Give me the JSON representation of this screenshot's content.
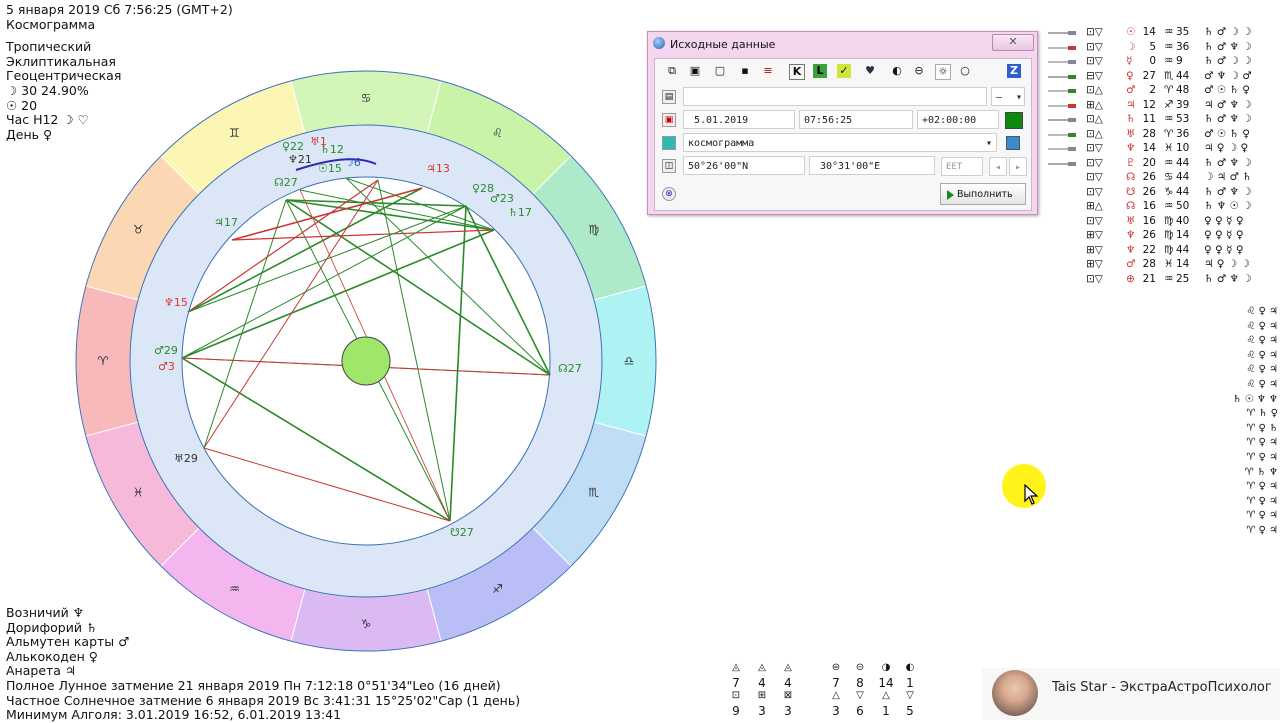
{
  "header": {
    "date_line": "5 января 2019  Сб   7:56:25 (GMT+2)",
    "chart_type": "Космограмма"
  },
  "settings": {
    "zodiac": "Тропический",
    "coords": "Эклиптикальная",
    "center": "Геоцентрическая",
    "moon_line": "☽  30 24.90%",
    "sun_line": "☉  20",
    "hour_line": "Час Н12  ☽ ♡",
    "day_line": "День ♀"
  },
  "bottom_info": [
    "Возничий ♆",
    "Дорифорий ♄",
    "Альмутен карты ♂",
    "Алькокоден ♀",
    "Анарета ♃",
    "Полное Лунное затмение 21 января 2019 Пн   7:12:18   0°51'34\"Leo (16 дней)",
    "Частное Солнечное затмение 6 января 2019 Вс   3:41:31  15°25'02\"Cap (1 день)",
    "Минимум Алголя: 3.01.2019 16:52,  6.01.2019 13:41"
  ],
  "wheel": {
    "signs": [
      "♈",
      "♉",
      "♊",
      "♋",
      "♌",
      "♍",
      "♎",
      "♏",
      "♐",
      "♑",
      "♒",
      "♓"
    ],
    "sign_colors": [
      "#f7b9b9",
      "#fbd7b3",
      "#fbf6b3",
      "#d4f5b8",
      "#c9f3a9",
      "#aee9c9",
      "#aef3f3",
      "#c0ddf6",
      "#b9bff6",
      "#dbb9f3",
      "#f4b6ee",
      "#f7b9d9"
    ],
    "planets": [
      {
        "g": "♅",
        "n": "1",
        "c": "#d33"
      },
      {
        "g": "♃",
        "n": "13",
        "c": "#d33"
      },
      {
        "g": "♀",
        "n": "22",
        "c": "#2a8a2a"
      },
      {
        "g": "♄",
        "n": "12",
        "c": "#2a8a2a"
      },
      {
        "g": "♆",
        "n": "21",
        "c": "#333"
      },
      {
        "g": "☉",
        "n": "15",
        "c": "#2a8a2a"
      },
      {
        "g": "☽",
        "n": "6",
        "c": "#2a5fb5"
      },
      {
        "g": "☊",
        "n": "27",
        "c": "#2a8a2a"
      },
      {
        "g": "♀",
        "n": "28",
        "c": "#2a8a2a"
      },
      {
        "g": "♂",
        "n": "23",
        "c": "#2a8a2a"
      },
      {
        "g": "♄",
        "n": "17",
        "c": "#2a8a2a"
      },
      {
        "g": "♃",
        "n": "17",
        "c": "#2a8a2a"
      },
      {
        "g": "♆",
        "n": "15",
        "c": "#d33"
      },
      {
        "g": "♂",
        "n": "29",
        "c": "#2a8a2a"
      },
      {
        "g": "♂",
        "n": "3",
        "c": "#d33"
      },
      {
        "g": "♅",
        "n": "29",
        "c": "#333"
      },
      {
        "g": "☊",
        "n": "27",
        "c": "#2a8a2a"
      },
      {
        "g": "☋",
        "n": "27",
        "c": "#2a8a2a"
      }
    ]
  },
  "dialog": {
    "title": "Исходные данные",
    "close": "✕",
    "date": "5.01.2019",
    "time": "07:56:25",
    "tz": "+02:00:00",
    "mode": "космограмма",
    "lat": "50°26'00\"N",
    "lon": "30°31'00\"E",
    "zone": "EET",
    "run": "Выполнить",
    "toolbar": [
      "⧉",
      "▣",
      "▢",
      "▪",
      "≡",
      "K",
      "L",
      "✓",
      "♥",
      "◐",
      "⊖",
      "☼",
      "○",
      "Z"
    ],
    "spin_left": "◂",
    "spin_right": "▸",
    "dropdown_dash": "—"
  },
  "aspect_table": {
    "rows": [
      {
        "a": "⊡▽",
        "p": "☉",
        "d": "14",
        "s": "♒",
        "m": "35",
        "e": "♄ ♂ ☽ ☽"
      },
      {
        "a": "⊡▽",
        "p": "☽",
        "d": "5",
        "s": "♒",
        "m": "36",
        "e": "♄ ♂ ♆ ☽"
      },
      {
        "a": "⊡▽",
        "p": "☿",
        "d": "0",
        "s": "♒",
        "m": "9",
        "e": "♄ ♂ ☽ ☽"
      },
      {
        "a": "⊟▽",
        "p": "♀",
        "d": "27",
        "s": "♏",
        "m": "44",
        "e": "♂ ♆ ☽ ♂"
      },
      {
        "a": "⊡△",
        "p": "♂",
        "d": "2",
        "s": "♈",
        "m": "48",
        "e": "♂ ☉ ♄ ♀"
      },
      {
        "a": "⊞△",
        "p": "♃",
        "d": "12",
        "s": "♐",
        "m": "39",
        "e": "♃ ♂ ♆ ☽"
      },
      {
        "a": "⊡△",
        "p": "♄",
        "d": "11",
        "s": "♒",
        "m": "53",
        "e": "♄ ♂ ♆ ☽"
      },
      {
        "a": "⊡△",
        "p": "♅",
        "d": "28",
        "s": "♈",
        "m": "36",
        "e": "♂ ☉ ♄ ♀"
      },
      {
        "a": "⊡▽",
        "p": "♆",
        "d": "14",
        "s": "♓",
        "m": "10",
        "e": "♃ ♀ ☽ ♀"
      },
      {
        "a": "⊡▽",
        "p": "♇",
        "d": "20",
        "s": "♒",
        "m": "44",
        "e": "♄ ♂ ♆ ☽"
      },
      {
        "a": "⊡▽",
        "p": "☊",
        "d": "26",
        "s": "♋",
        "m": "44",
        "e": "☽ ♃ ♂ ♄"
      },
      {
        "a": "⊡▽",
        "p": "☋",
        "d": "26",
        "s": "♑",
        "m": "44",
        "e": "♄ ♂ ♆ ☽"
      },
      {
        "a": "⊞△",
        "p": "☊",
        "d": "16",
        "s": "♒",
        "m": "50",
        "e": "♄ ♆ ☉ ☽"
      },
      {
        "a": "⊡▽",
        "p": "♅",
        "d": "16",
        "s": "♍",
        "m": "40",
        "e": "♀ ♀ ☿ ♀"
      },
      {
        "a": "⊞▽",
        "p": "♆",
        "d": "26",
        "s": "♍",
        "m": "14",
        "e": "♀ ♀ ☿ ♀"
      },
      {
        "a": "⊞▽",
        "p": "♆",
        "d": "22",
        "s": "♍",
        "m": "44",
        "e": "♀ ♀ ☿ ♀"
      },
      {
        "a": "⊞▽",
        "p": "♂",
        "d": "28",
        "s": "♓",
        "m": "14",
        "e": "♃ ♀ ☽ ☽"
      },
      {
        "a": "⊡▽",
        "p": "⊕",
        "d": "21",
        "s": "♒",
        "m": "25",
        "e": "♄ ♂ ♆ ☽"
      }
    ]
  },
  "glyph_column": [
    "♌ ♀ ♃",
    "♌ ♀ ♃",
    "♌ ♀ ♃",
    "♌ ♀ ♃",
    "♌ ♀ ♃",
    "♌ ♀ ♃",
    "♄ ☉ ♆ ♆",
    "♈ ♄ ♀",
    "♈ ♀ ♄",
    "♈ ♀ ♃",
    "♈ ♀ ♃",
    "♈ ♄ ♆",
    "♈ ♀ ♃",
    "♈ ♀ ♃",
    "♈ ♀ ♃",
    "♈ ♀ ♃"
  ],
  "stats": {
    "row1": [
      "◬",
      "◬",
      "◬",
      "",
      "⊜",
      "⊝",
      "◑",
      "◐"
    ],
    "row2": [
      "7",
      "4",
      "4",
      "",
      "7",
      "8",
      "14",
      "1"
    ],
    "row3": [
      "⊡",
      "⊞",
      "⊠",
      "",
      "△",
      "▽",
      "△",
      "▽"
    ],
    "row4": [
      "9",
      "3",
      "3",
      "",
      "3",
      "6",
      "1",
      "5"
    ]
  },
  "author": {
    "name": "Tais Star - ЭкстраАстроПсихолог"
  }
}
